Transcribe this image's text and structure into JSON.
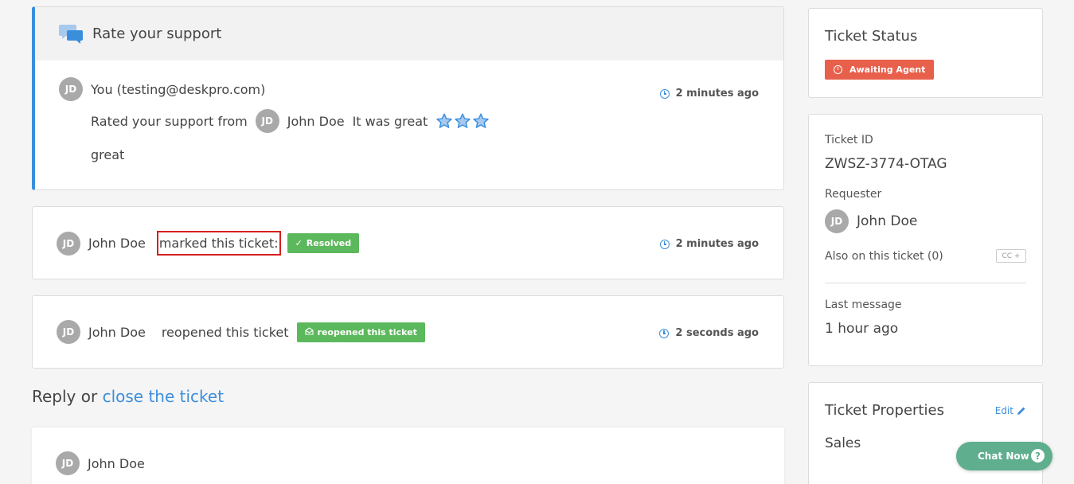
{
  "rating": {
    "title": "Rate your support",
    "avatar_initials": "JD",
    "author": "You (testing@deskpro.com)",
    "time": "2 minutes ago",
    "rated_text": "Rated your support from",
    "agent_initials": "JD",
    "agent_name": "John Doe",
    "verdict": "It was great",
    "stars": 3,
    "comment": "great"
  },
  "events": [
    {
      "avatar_initials": "JD",
      "name": "John Doe",
      "action": "marked this ticket:",
      "badge": "Resolved",
      "time": "2 minutes ago"
    },
    {
      "avatar_initials": "JD",
      "name": "John Doe",
      "action": "reopened this ticket",
      "badge": "reopened this ticket",
      "time": "2 seconds ago"
    }
  ],
  "reply": {
    "prefix": "Reply or",
    "link": "close the ticket",
    "avatar_initials": "JD",
    "name": "John Doe"
  },
  "sidebar": {
    "status": {
      "heading": "Ticket Status",
      "badge": "Awaiting Agent"
    },
    "info": {
      "ticket_id_label": "Ticket ID",
      "ticket_id": "ZWSZ-3774-OTAG",
      "requester_label": "Requester",
      "requester_initials": "JD",
      "requester_name": "John Doe",
      "also_label": "Also on this ticket (0)",
      "cc_label": "CC +",
      "last_message_label": "Last message",
      "last_message": "1 hour ago"
    },
    "properties": {
      "heading": "Ticket Properties",
      "edit_label": "Edit",
      "value": "Sales"
    }
  },
  "chat": {
    "label": "Chat Now",
    "help": "?"
  },
  "colors": {
    "accent": "#3b8edc",
    "success": "#5cb85c",
    "warning": "#e8604c",
    "chat": "#5fae8e",
    "highlight_border": "#d61f1f"
  }
}
